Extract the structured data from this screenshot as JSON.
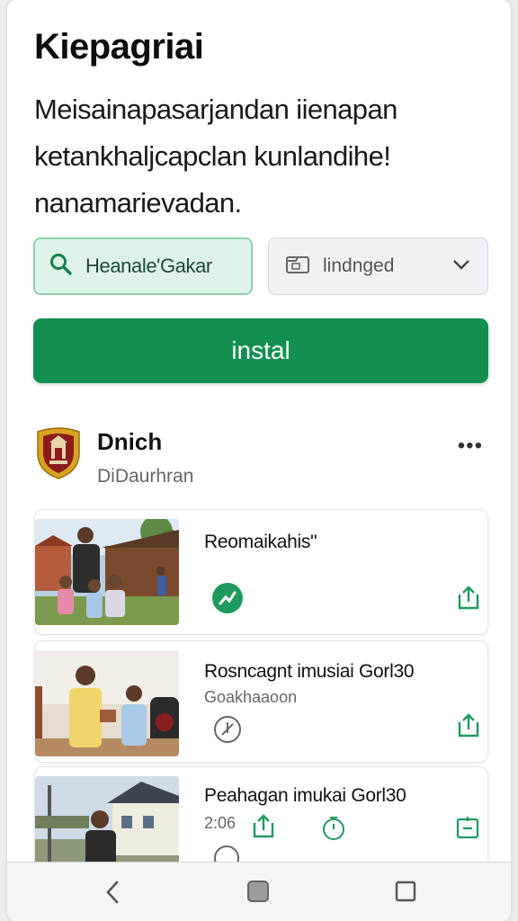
{
  "app": {
    "title": "Kiepagriai",
    "description": "Meisainapasarjandan iienapan ketankhaljcapclan kunlandihe! nanamarievadan."
  },
  "actions": {
    "search_label": "Heanale'Gakar",
    "select_label": "lindnged",
    "install_label": "instal"
  },
  "publisher": {
    "name": "Dnich",
    "subtitle": "DiDaurhran",
    "more_label": "•••"
  },
  "items": [
    {
      "title": "Reomaikahis\"",
      "subtitle": ""
    },
    {
      "title": "Rosncagnt imusiai Gorl30",
      "subtitle": "Goakhaaoon"
    },
    {
      "title": "Peahagan imukai Gorl30",
      "subtitle": "2:06"
    }
  ],
  "colors": {
    "primary_green": "#11904f",
    "light_green": "#dff4e8",
    "icon_green": "#1f9a5e"
  },
  "icons": [
    "search-icon",
    "folder-icon",
    "chevron-down-icon",
    "share-icon",
    "download-icon",
    "timer-icon",
    "back-icon",
    "home-icon",
    "recents-icon"
  ]
}
